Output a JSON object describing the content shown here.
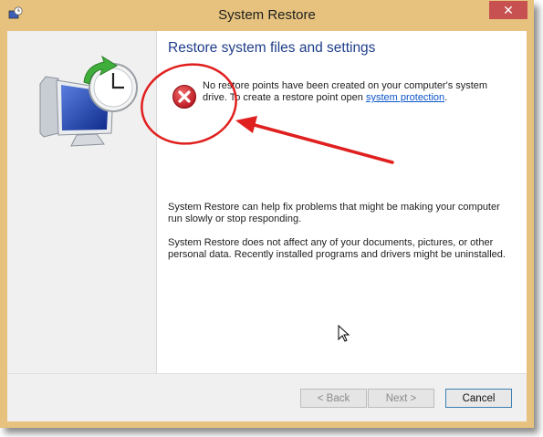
{
  "window": {
    "title": "System Restore",
    "close_glyph": "✕"
  },
  "content": {
    "heading": "Restore system files and settings",
    "error_line1": "No restore points have been created on your computer's system",
    "error_line2a": "drive. To create a restore point open ",
    "error_link": "system protection",
    "error_line2b": ".",
    "para1": "System Restore can help fix problems that might be making your computer run slowly or stop responding.",
    "para2": "System Restore does not affect any of your documents, pictures, or other personal data. Recently installed programs and drivers might be uninstalled."
  },
  "buttons": {
    "back": "< Back",
    "next": "Next >",
    "cancel": "Cancel"
  },
  "icons": {
    "app": "system-restore-icon",
    "error": "error-icon",
    "illustration": "computer-clock-icon",
    "cursor": "mouse-cursor-icon"
  },
  "colors": {
    "titlebar": "#e6c27e",
    "close": "#c75050",
    "heading": "#1f3e8a",
    "link": "#0b54c9",
    "annotation": "#e01f1f"
  }
}
